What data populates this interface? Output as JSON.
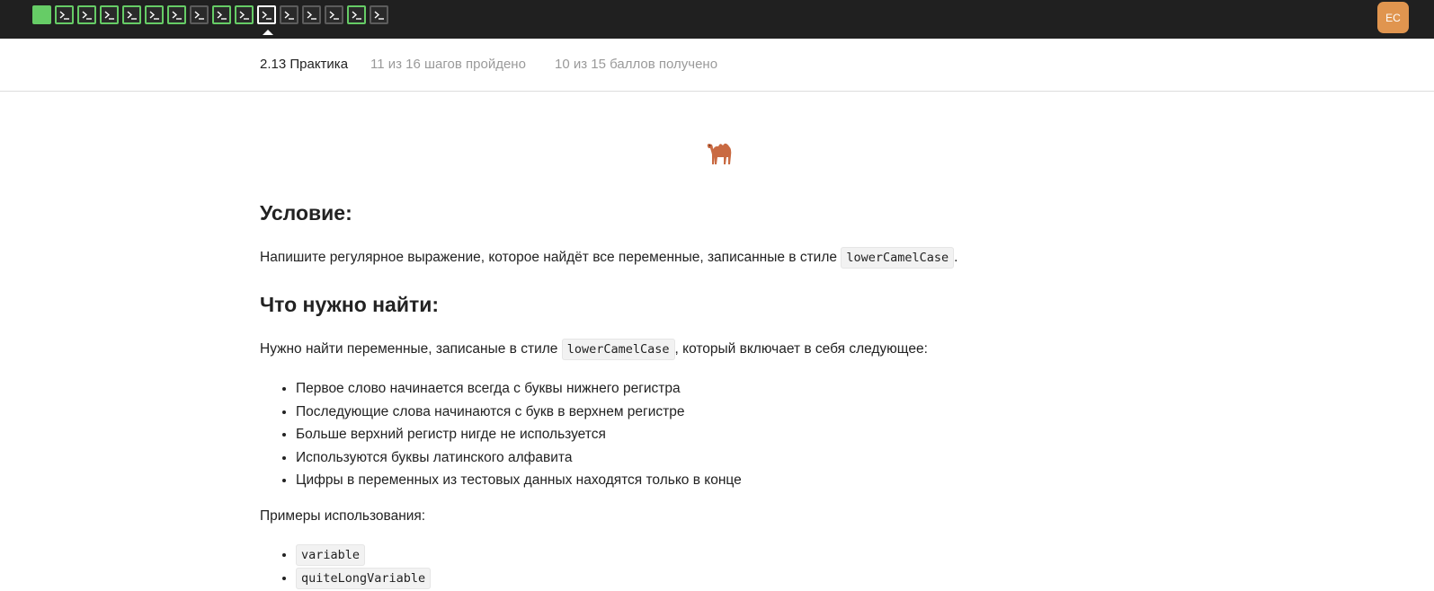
{
  "topbar": {
    "steps": [
      {
        "state": "filled",
        "icon": "terminal-icon"
      },
      {
        "state": "passed",
        "icon": "terminal-icon"
      },
      {
        "state": "passed",
        "icon": "terminal-icon"
      },
      {
        "state": "passed",
        "icon": "terminal-icon"
      },
      {
        "state": "passed",
        "icon": "terminal-icon"
      },
      {
        "state": "passed",
        "icon": "terminal-icon"
      },
      {
        "state": "passed",
        "icon": "terminal-icon"
      },
      {
        "state": "todo",
        "icon": "terminal-icon"
      },
      {
        "state": "passed",
        "icon": "terminal-icon"
      },
      {
        "state": "passed",
        "icon": "terminal-icon"
      },
      {
        "state": "current",
        "icon": "terminal-icon"
      },
      {
        "state": "todo",
        "icon": "terminal-icon"
      },
      {
        "state": "todo",
        "icon": "terminal-icon"
      },
      {
        "state": "todo",
        "icon": "terminal-icon"
      },
      {
        "state": "passed",
        "icon": "terminal-icon"
      },
      {
        "state": "todo",
        "icon": "terminal-icon"
      }
    ],
    "avatar_initials": "EC",
    "colors": {
      "passed": "#66cc66",
      "todo": "#5c5c5c",
      "bar": "#202020",
      "avatar": "#e0954f"
    }
  },
  "lesson": {
    "title": "2.13 Практика",
    "progress": "11 из 16 шагов пройдено",
    "score": "10 из 15 баллов  получено"
  },
  "content": {
    "emoji": "camel-icon",
    "heading_condition": "Условие:",
    "task_text_before": "Напишите регулярное выражение, которое найдёт все переменные, записанные в стиле",
    "task_code": "lowerCamelCase",
    "task_text_after": ".",
    "heading_find": "Что нужно найти:",
    "find_text_before": "Нужно найти переменные, записаные в стиле",
    "find_code": "lowerCamelCase",
    "find_text_after": ", который включает в себя следующее:",
    "rules": [
      "Первое слово начинается всегда с буквы нижнего регистра",
      "Последующие слова начинаются с букв в верхнем регистре",
      "Больше верхний регистр нигде не используется",
      "Используются буквы латинского алфавита",
      "Цифры в переменных из тестовых данных находятся только в конце"
    ],
    "examples_label": "Примеры использования:",
    "examples": [
      "variable",
      "quiteLongVariable"
    ]
  }
}
